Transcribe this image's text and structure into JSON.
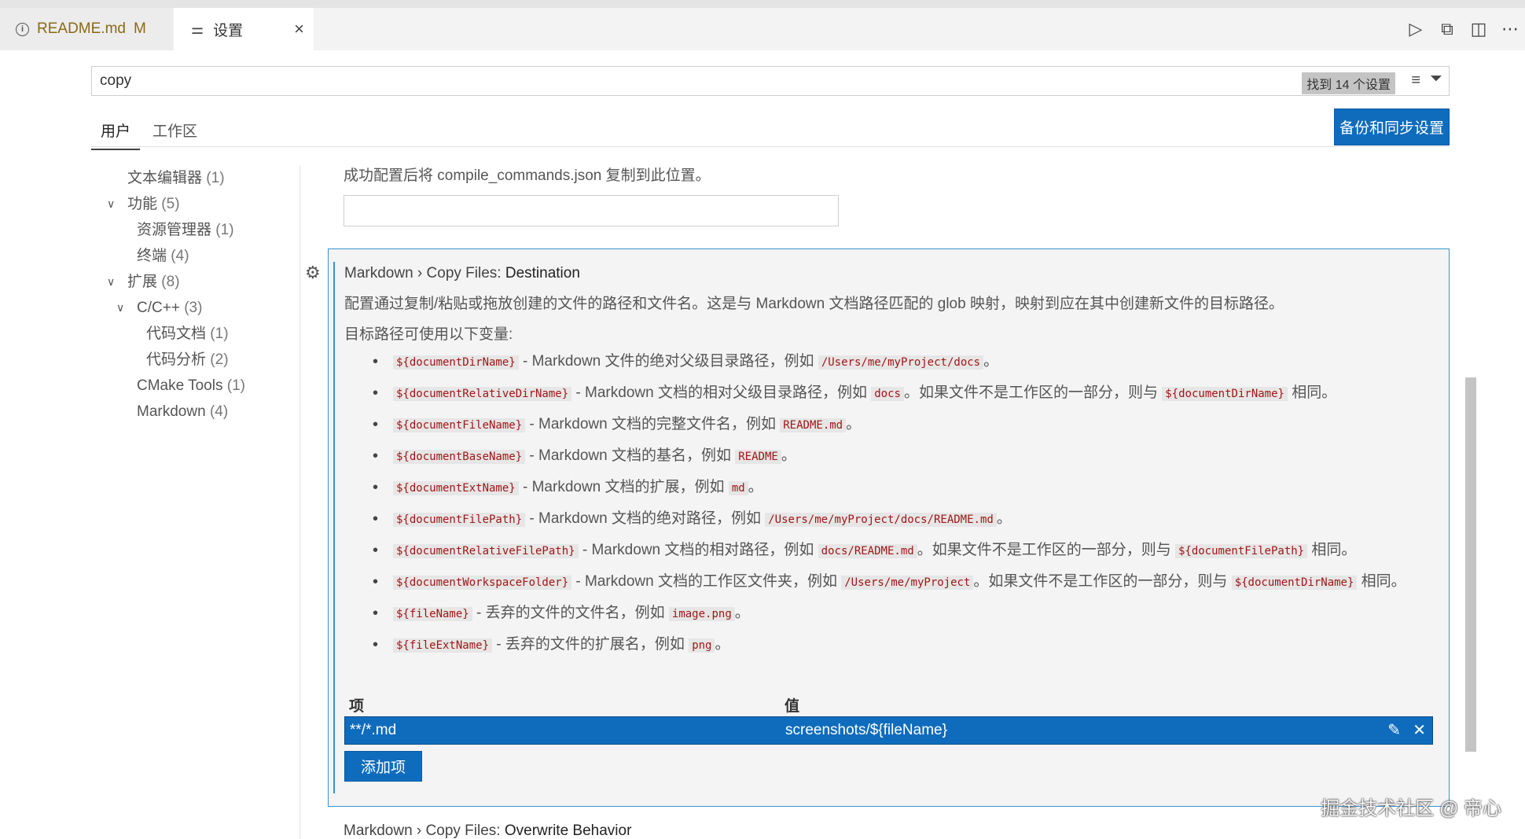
{
  "tabs": {
    "readme_label": "README.md",
    "readme_status": "M",
    "settings_label": "设置"
  },
  "search": {
    "value": "copy",
    "result_count": "找到 14 个设置"
  },
  "scope": {
    "user": "用户",
    "workspace": "工作区",
    "sync_button": "备份和同步设置"
  },
  "toc": [
    {
      "label": "文本编辑器",
      "count": "(1)"
    },
    {
      "label": "功能",
      "count": "(5)"
    },
    {
      "label": "资源管理器",
      "count": "(1)"
    },
    {
      "label": "终端",
      "count": "(4)"
    },
    {
      "label": "扩展",
      "count": "(8)"
    },
    {
      "label": "C/C++",
      "count": "(3)"
    },
    {
      "label": "代码文档",
      "count": "(1)"
    },
    {
      "label": "代码分析",
      "count": "(2)"
    },
    {
      "label": "CMake Tools",
      "count": "(1)"
    },
    {
      "label": "Markdown",
      "count": "(4)"
    }
  ],
  "prev_setting": {
    "description": "成功配置后将 compile_commands.json 复制到此位置。"
  },
  "setting": {
    "category": "Markdown › Copy Files: ",
    "name": "Destination",
    "description": "配置通过复制/粘贴或拖放创建的文件的路径和文件名。这是与 Markdown 文档路径匹配的 glob 映射，映射到应在其中创建新文件的目标路径。",
    "vars_intro": "目标路径可使用以下变量:",
    "vars": [
      {
        "code": "${documentDirName}",
        "text1": " - Markdown 文件的绝对父级目录路径，例如 ",
        "ex": "/Users/me/myProject/docs",
        "text2": "。",
        "code2": "",
        "text3": ""
      },
      {
        "code": "${documentRelativeDirName}",
        "text1": " - Markdown 文档的相对父级目录路径，例如 ",
        "ex": "docs",
        "text2": "。如果文件不是工作区的一部分，则与 ",
        "code2": "${documentDirName}",
        "text3": " 相同。"
      },
      {
        "code": "${documentFileName}",
        "text1": " - Markdown 文档的完整文件名，例如 ",
        "ex": "README.md",
        "text2": "。",
        "code2": "",
        "text3": ""
      },
      {
        "code": "${documentBaseName}",
        "text1": " - Markdown 文档的基名，例如 ",
        "ex": "README",
        "text2": "。",
        "code2": "",
        "text3": ""
      },
      {
        "code": "${documentExtName}",
        "text1": " - Markdown 文档的扩展，例如 ",
        "ex": "md",
        "text2": "。",
        "code2": "",
        "text3": ""
      },
      {
        "code": "${documentFilePath}",
        "text1": " - Markdown 文档的绝对路径，例如 ",
        "ex": "/Users/me/myProject/docs/README.md",
        "text2": "。",
        "code2": "",
        "text3": ""
      },
      {
        "code": "${documentRelativeFilePath}",
        "text1": " - Markdown 文档的相对路径，例如 ",
        "ex": "docs/README.md",
        "text2": "。如果文件不是工作区的一部分，则与 ",
        "code2": "${documentFilePath}",
        "text3": " 相同。"
      },
      {
        "code": "${documentWorkspaceFolder}",
        "text1": " - Markdown 文档的工作区文件夹，例如 ",
        "ex": "/Users/me/myProject",
        "text2": "。如果文件不是工作区的一部分，则与 ",
        "code2": "${documentDirName}",
        "text3": " 相同。"
      },
      {
        "code": "${fileName}",
        "text1": " - 丢弃的文件的文件名，例如 ",
        "ex": "image.png",
        "text2": "。",
        "code2": "",
        "text3": ""
      },
      {
        "code": "${fileExtName}",
        "text1": " - 丢弃的文件的扩展名，例如 ",
        "ex": "png",
        "text2": "。",
        "code2": "",
        "text3": ""
      }
    ],
    "table": {
      "col_item": "项",
      "col_value": "值",
      "row_item": "**/*.md",
      "row_value": "screenshots/${fileName}"
    },
    "add_button": "添加项"
  },
  "next_setting": {
    "category": "Markdown › Copy Files: ",
    "name": "Overwrite Behavior"
  },
  "watermark": "掘金技术社区 @ 帝心"
}
